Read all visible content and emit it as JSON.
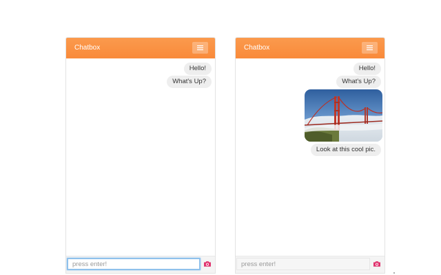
{
  "colors": {
    "header_accent": "#f98a3a",
    "bubble_bg": "#eeeeee",
    "camera_icon": "#e0336e",
    "focus_ring": "#8fc1ec"
  },
  "chatboxes": [
    {
      "title": "Chatbox",
      "menu_icon": "hamburger-icon",
      "messages": [
        {
          "type": "text",
          "text": "Hello!"
        },
        {
          "type": "text",
          "text": "What's Up?"
        }
      ],
      "input": {
        "placeholder": "press enter!",
        "value": "",
        "focused": true
      },
      "camera_icon": "camera-icon"
    },
    {
      "title": "Chatbox",
      "menu_icon": "hamburger-icon",
      "messages": [
        {
          "type": "text",
          "text": "Hello!"
        },
        {
          "type": "text",
          "text": "What's Up?"
        },
        {
          "type": "image",
          "icon": "golden-gate-bridge-photo"
        },
        {
          "type": "text",
          "text": "Look at this cool pic."
        }
      ],
      "input": {
        "placeholder": "press enter!",
        "value": "",
        "focused": false
      },
      "camera_icon": "camera-icon"
    }
  ]
}
